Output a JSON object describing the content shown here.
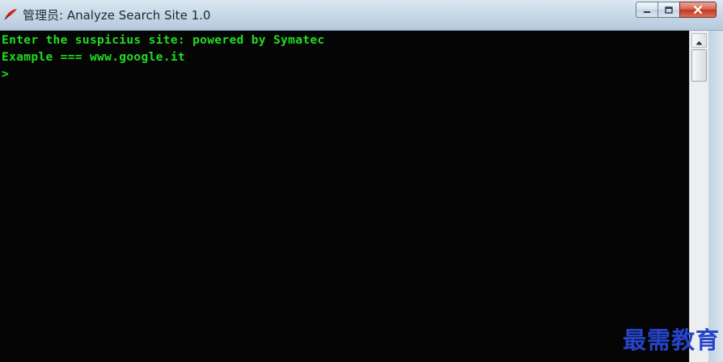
{
  "window": {
    "title": "管理员: Analyze Search Site 1.0",
    "icon": "red-feather-icon"
  },
  "controls": {
    "minimize_icon": "minimize-icon",
    "maximize_icon": "maximize-icon",
    "close_icon": "close-icon"
  },
  "console": {
    "lines": [
      "Enter the suspicius site: powered by Symatec",
      "Example === www.google.it",
      ">"
    ],
    "text_color": "#22dd22",
    "background": "#050505"
  },
  "scrollbar": {
    "up_icon": "scroll-up-arrow-icon"
  },
  "watermark": {
    "text": "最需教育"
  }
}
